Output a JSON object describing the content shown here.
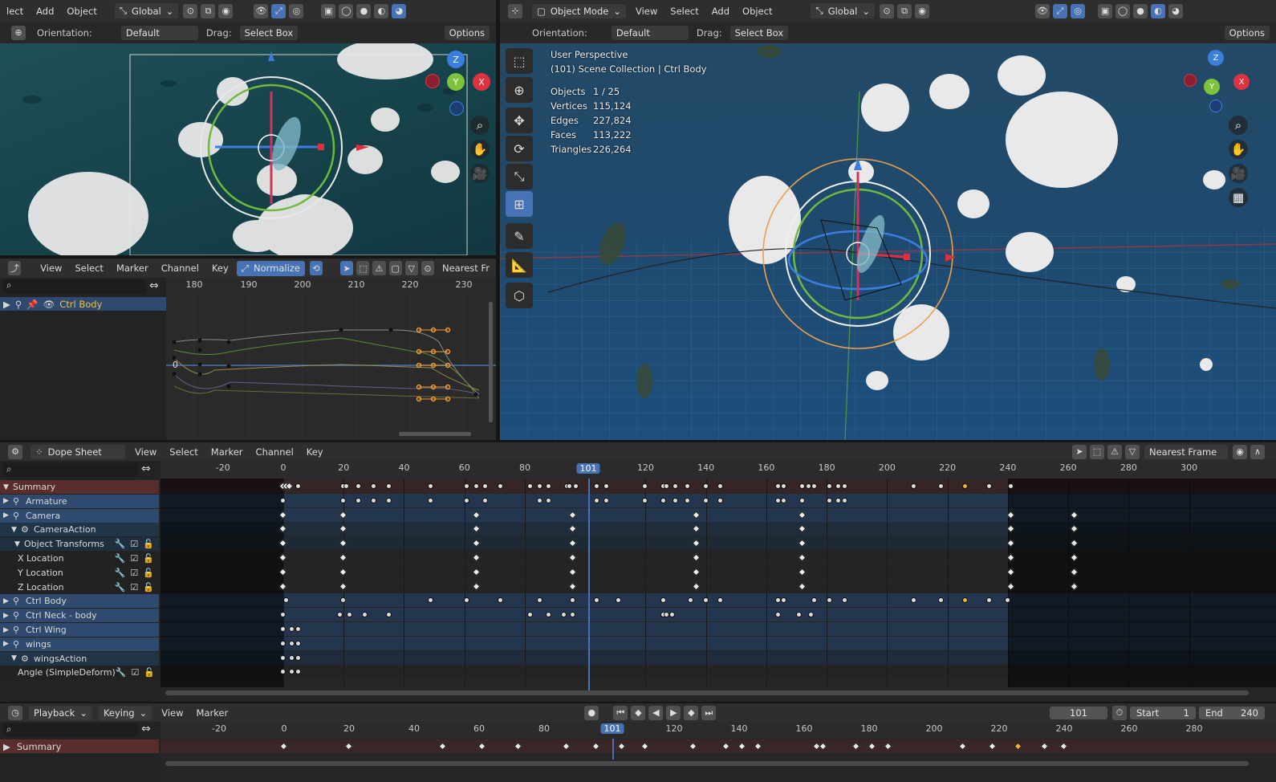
{
  "top_left": {
    "menu": [
      "lect",
      "Add",
      "Object"
    ],
    "orientation_mode": "Global",
    "orientation_label": "Orientation:",
    "orientation_value": "Default",
    "drag_label": "Drag:",
    "drag_value": "Select Box",
    "options": "Options"
  },
  "top_right": {
    "mode": "Object Mode",
    "menu": [
      "View",
      "Select",
      "Add",
      "Object"
    ],
    "orientation_mode": "Global",
    "orientation_label": "Orientation:",
    "orientation_value": "Default",
    "drag_label": "Drag:",
    "drag_value": "Select Box",
    "options": "Options",
    "overlay_title": "User Perspective",
    "overlay_collection": "(101) Scene Collection | Ctrl Body",
    "stats": [
      {
        "label": "Objects",
        "value": "1 / 25"
      },
      {
        "label": "Vertices",
        "value": "115,124"
      },
      {
        "label": "Edges",
        "value": "227,824"
      },
      {
        "label": "Faces",
        "value": "113,222"
      },
      {
        "label": "Triangles",
        "value": "226,264"
      }
    ],
    "gizmo_axes": {
      "z": "Z",
      "y": "Y",
      "x": "X"
    }
  },
  "graph_editor": {
    "menu": [
      "View",
      "Select",
      "Marker",
      "Channel",
      "Key"
    ],
    "normalize": "Normalize",
    "snap": "Nearest Fr",
    "ruler": [
      "180",
      "190",
      "200",
      "210",
      "220",
      "230"
    ],
    "channel": "Ctrl Body",
    "zero": "0"
  },
  "dope_sheet": {
    "mode": "Dope Sheet",
    "menu": [
      "View",
      "Select",
      "Marker",
      "Channel",
      "Key"
    ],
    "snap": "Nearest Frame",
    "ruler": [
      "-20",
      "0",
      "20",
      "40",
      "60",
      "80",
      "120",
      "140",
      "160",
      "180",
      "200",
      "220",
      "240",
      "260",
      "280",
      "300"
    ],
    "current_frame": "101",
    "channels": [
      {
        "label": "Summary",
        "kind": "summary"
      },
      {
        "label": "Armature",
        "kind": "object"
      },
      {
        "label": "Camera",
        "kind": "object"
      },
      {
        "label": "CameraAction",
        "kind": "action"
      },
      {
        "label": "Object Transforms",
        "kind": "group"
      },
      {
        "label": "X Location",
        "kind": "fcurve"
      },
      {
        "label": "Y Location",
        "kind": "fcurve"
      },
      {
        "label": "Z Location",
        "kind": "fcurve"
      },
      {
        "label": "Ctrl Body",
        "kind": "object"
      },
      {
        "label": "Ctrl Neck - body",
        "kind": "object"
      },
      {
        "label": "Ctrl Wing",
        "kind": "object"
      },
      {
        "label": "wings",
        "kind": "object"
      },
      {
        "label": "wingsAction",
        "kind": "action"
      },
      {
        "label": "Angle (SimpleDeform)",
        "kind": "fcurve"
      }
    ]
  },
  "timeline": {
    "menu": [
      "Playback",
      "Keying",
      "View",
      "Marker"
    ],
    "frame": "101",
    "start_label": "Start",
    "start_value": "1",
    "end_label": "End",
    "end_value": "240",
    "ruler": [
      "-20",
      "0",
      "20",
      "40",
      "60",
      "80",
      "120",
      "140",
      "160",
      "180",
      "200",
      "220",
      "240",
      "260",
      "280"
    ],
    "current_frame": "101",
    "summary": "Summary"
  },
  "colors": {
    "accent": "#4772b3",
    "summary_row": "#5a2d2d",
    "object_row": "#2f4a6e",
    "selected_key": "#f0b23a"
  }
}
